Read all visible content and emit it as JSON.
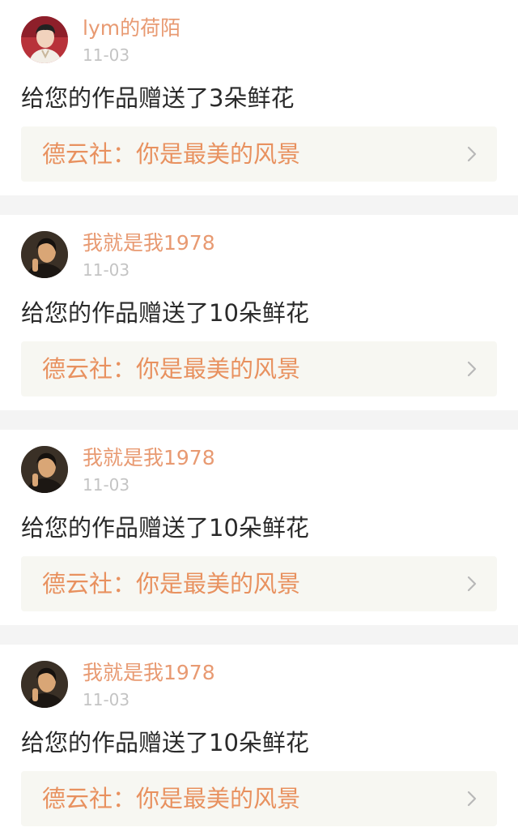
{
  "notifications": [
    {
      "username": "lym的荷陌",
      "date": "11-03",
      "message": "给您的作品赠送了3朵鲜花",
      "work_title": "德云社：你是最美的风景",
      "avatar": "avatar-photo-young-man-red-background"
    },
    {
      "username": "我就是我1978",
      "date": "11-03",
      "message": "给您的作品赠送了10朵鲜花",
      "work_title": "德云社：你是最美的风景",
      "avatar": "avatar-photo-man-dark-background"
    },
    {
      "username": "我就是我1978",
      "date": "11-03",
      "message": "给您的作品赠送了10朵鲜花",
      "work_title": "德云社：你是最美的风景",
      "avatar": "avatar-photo-man-dark-background"
    },
    {
      "username": "我就是我1978",
      "date": "11-03",
      "message": "给您的作品赠送了10朵鲜花",
      "work_title": "德云社：你是最美的风景",
      "avatar": "avatar-photo-man-dark-background"
    }
  ],
  "colors": {
    "username": "#e89a72",
    "date": "#c4c4c4",
    "message": "#2a2a2a",
    "work_title": "#e8915f",
    "work_link_bg": "#f7f7f2",
    "separator": "#f4f4f4"
  },
  "icons": {
    "chevron": "chevron-right-icon"
  }
}
